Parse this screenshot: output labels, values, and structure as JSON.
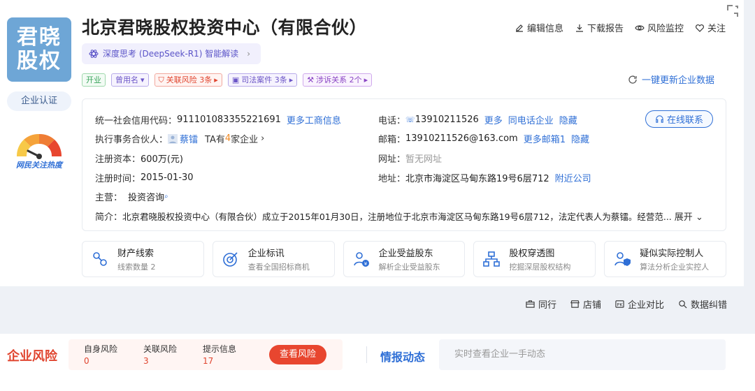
{
  "company": {
    "logo_text": "君晓股权",
    "name": "北京君晓股权投资中心（有限合伙）",
    "certification": "企业认证",
    "heat_label": "网民关注热度"
  },
  "ai_chip": {
    "label": "深度思考 (DeepSeek-R1) 智能解读",
    "arrow": "›"
  },
  "top_actions": [
    {
      "label": "编辑信息",
      "icon": "edit-icon"
    },
    {
      "label": "下载报告",
      "icon": "download-icon"
    },
    {
      "label": "风险监控",
      "icon": "eye-icon"
    },
    {
      "label": "关注",
      "icon": "heart-icon"
    }
  ],
  "tags": {
    "status": "开业",
    "former_name": "曾用名",
    "related_risk": "关联风险 3条",
    "judicial": "司法案件 3条",
    "litigation": "涉诉关系 2个"
  },
  "refresh_label": "一键更新企业数据",
  "info": {
    "credit_code_label": "统一社会信用代码：",
    "credit_code": "911101083355221691",
    "more_business": "更多工商信息",
    "partner_label": "执行事务合伙人：",
    "partner_name": "蔡镭",
    "partner_ta": "TA有",
    "partner_count": "4",
    "partner_suffix": "家企业",
    "capital_label": "注册资本：",
    "capital": "600万(元)",
    "reg_date_label": "注册时间：",
    "reg_date": "2015-01-30",
    "business_label": "主营：",
    "business": "投资咨询",
    "phone_label": "电话：",
    "phone": "13910211526",
    "phone_more": "更多",
    "phone_same": "同电话企业",
    "phone_hide": "隐藏",
    "email_label": "邮箱：",
    "email": "13910211526@163.com",
    "email_more": "更多邮箱1",
    "email_hide": "隐藏",
    "website_label": "网址：",
    "website": "暂无网址",
    "address_label": "地址：",
    "address": "北京市海淀区马甸东路19号6层712",
    "nearby": "附近公司",
    "online_contact": "在线联系",
    "intro_label": "简介：",
    "intro": "北京君晓股权投资中心（有限合伙）成立于2015年01月30日，注册地位于北京市海淀区马甸东路19号6层712，法定代表人为蔡镭。经营范...",
    "expand": "展开"
  },
  "tiles": [
    {
      "title": "财产线索",
      "sub": "线索数量 2",
      "icon": "property-clue-icon"
    },
    {
      "title": "企业标讯",
      "sub": "查看全国招标商机",
      "icon": "bid-target-icon"
    },
    {
      "title": "企业受益股东",
      "sub": "解析企业受益股东",
      "icon": "beneficiary-icon"
    },
    {
      "title": "股权穿透图",
      "sub": "挖掘深层股权结构",
      "icon": "equity-tree-icon"
    },
    {
      "title": "疑似实际控制人",
      "sub": "算法分析企业实控人",
      "icon": "controller-icon"
    }
  ],
  "bottom_actions": [
    {
      "label": "同行",
      "icon": "briefcase-icon"
    },
    {
      "label": "店铺",
      "icon": "shop-icon"
    },
    {
      "label": "企业对比",
      "icon": "compare-icon"
    },
    {
      "label": "数据纠错",
      "icon": "correction-icon"
    }
  ],
  "risk": {
    "title": "企业风险",
    "self_label": "自身风险",
    "self_count": "0",
    "related_label": "关联风险",
    "related_count": "3",
    "hint_label": "提示信息",
    "hint_count": "17",
    "button": "查看风险"
  },
  "intel": {
    "title": "情报动态",
    "placeholder": "实时查看企业一手动态"
  },
  "colors": {
    "accent": "#2f6fd6",
    "danger": "#e0452f",
    "logo_bg": "#6ea6d6"
  }
}
